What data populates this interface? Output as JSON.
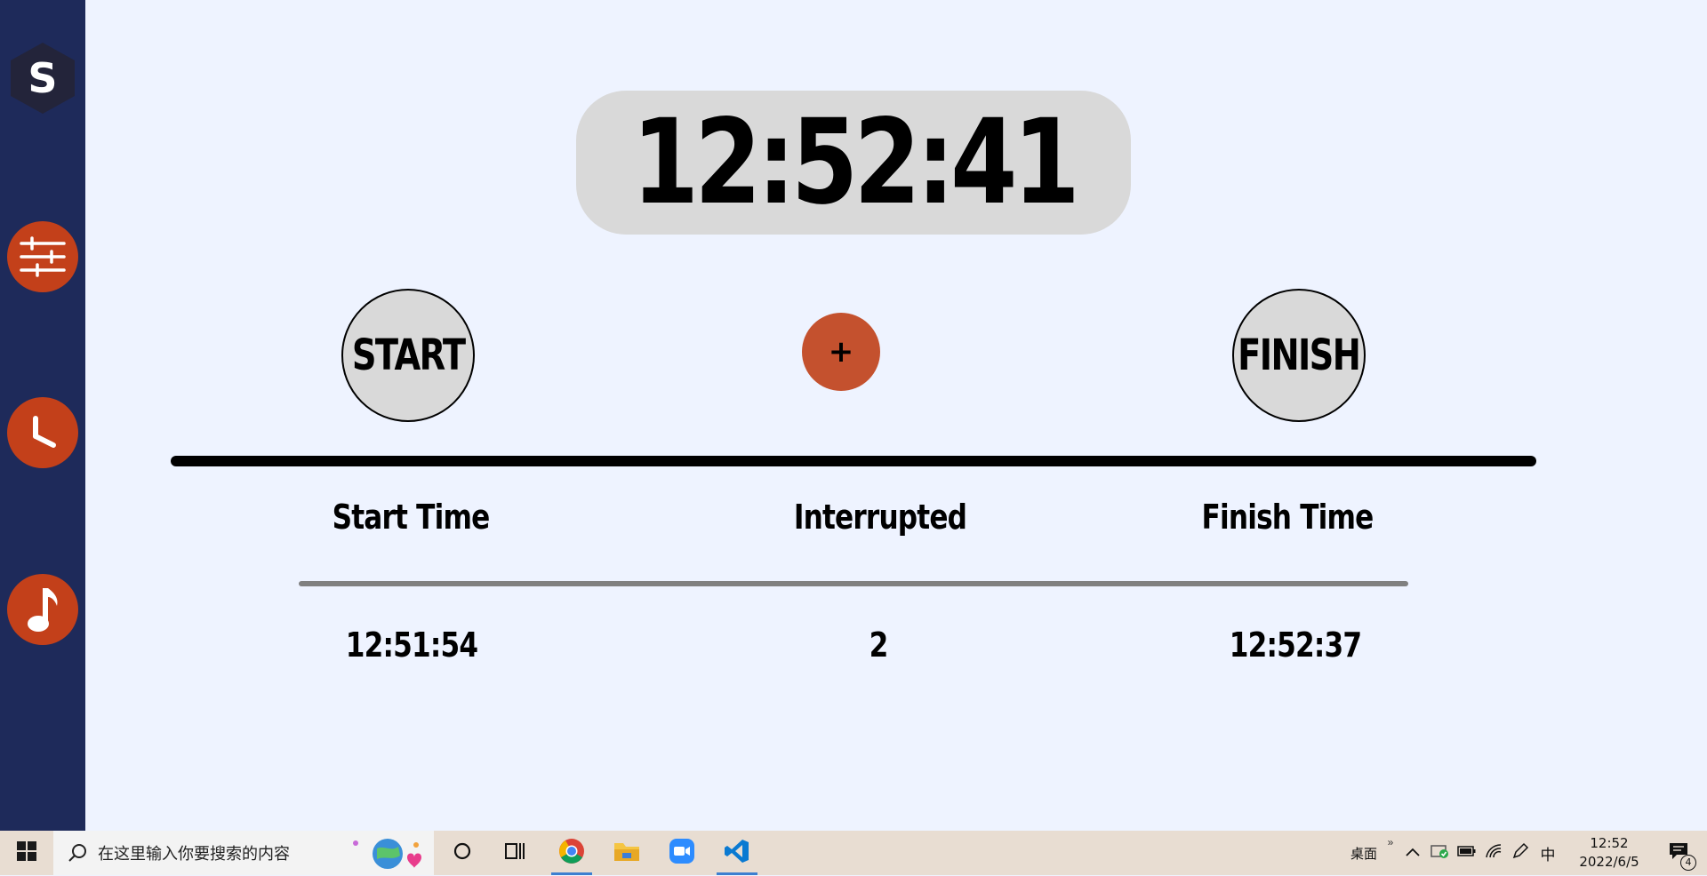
{
  "app": {
    "clock": "12:52:41",
    "start_button_label": "START",
    "finish_button_label": "FINISH",
    "plus_button_label": "+",
    "logo_letter": "S",
    "columns": {
      "start_label": "Start Time",
      "interrupted_label": "Interrupted",
      "finish_label": "Finish Time",
      "start_value": "12:51:54",
      "interrupted_value": "2",
      "finish_value": "12:52:37"
    },
    "sidebar": {
      "items": [
        {
          "icon": "settings-sliders-icon"
        },
        {
          "icon": "clock-icon"
        },
        {
          "icon": "music-note-icon"
        }
      ]
    },
    "colors": {
      "sidebar_bg": "#1e2a5a",
      "accent": "#c3401a",
      "plus_bg": "#c4512e",
      "pill_bg": "#d9d9d9",
      "page_bg": "#eef3ff"
    }
  },
  "taskbar": {
    "search_placeholder": "在这里输入你要搜索的内容",
    "desktop_label": "桌面",
    "ime_label": "中",
    "time": "12:52",
    "date": "2022/6/5",
    "notification_count": "4"
  }
}
